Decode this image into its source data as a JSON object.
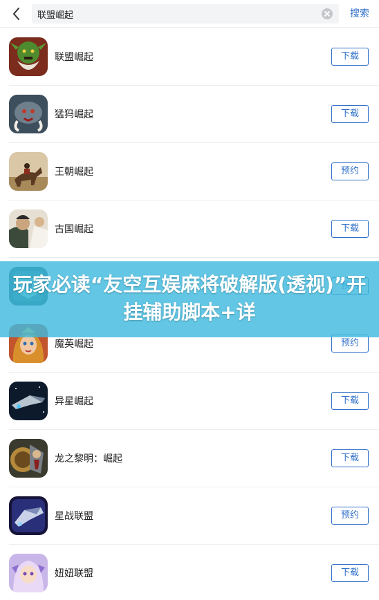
{
  "search": {
    "query": "联盟崛起",
    "button_label": "搜索"
  },
  "results": [
    {
      "name": "联盟崛起",
      "action": "下载",
      "icon": "orc-warrior-icon"
    },
    {
      "name": "猛犸崛起",
      "action": "下载",
      "icon": "mammoth-icon"
    },
    {
      "name": "王朝崛起",
      "action": "预约",
      "icon": "horseman-icon"
    },
    {
      "name": "古国崛起",
      "action": "下载",
      "icon": "ancient-general-icon"
    },
    {
      "name": "",
      "action": "预约",
      "icon": "war-emblem-icon"
    },
    {
      "name": "魔英崛起",
      "action": "预约",
      "icon": "fantasy-heroine-icon"
    },
    {
      "name": "异星崛起",
      "action": "下载",
      "icon": "spaceship-icon"
    },
    {
      "name": "龙之黎明：崛起",
      "action": "下载",
      "icon": "dragon-warrior-icon"
    },
    {
      "name": "星战联盟",
      "action": "预约",
      "icon": "space-fleet-icon"
    },
    {
      "name": "妞妞联盟",
      "action": "下载",
      "icon": "anime-girl-icon"
    }
  ],
  "banner": {
    "title": "玩家必读“友空互娱麻将破解版(透视)”开挂辅助脚本+详"
  },
  "colors": {
    "accent": "#2f6fc8",
    "banner_bg": "#40bade"
  }
}
